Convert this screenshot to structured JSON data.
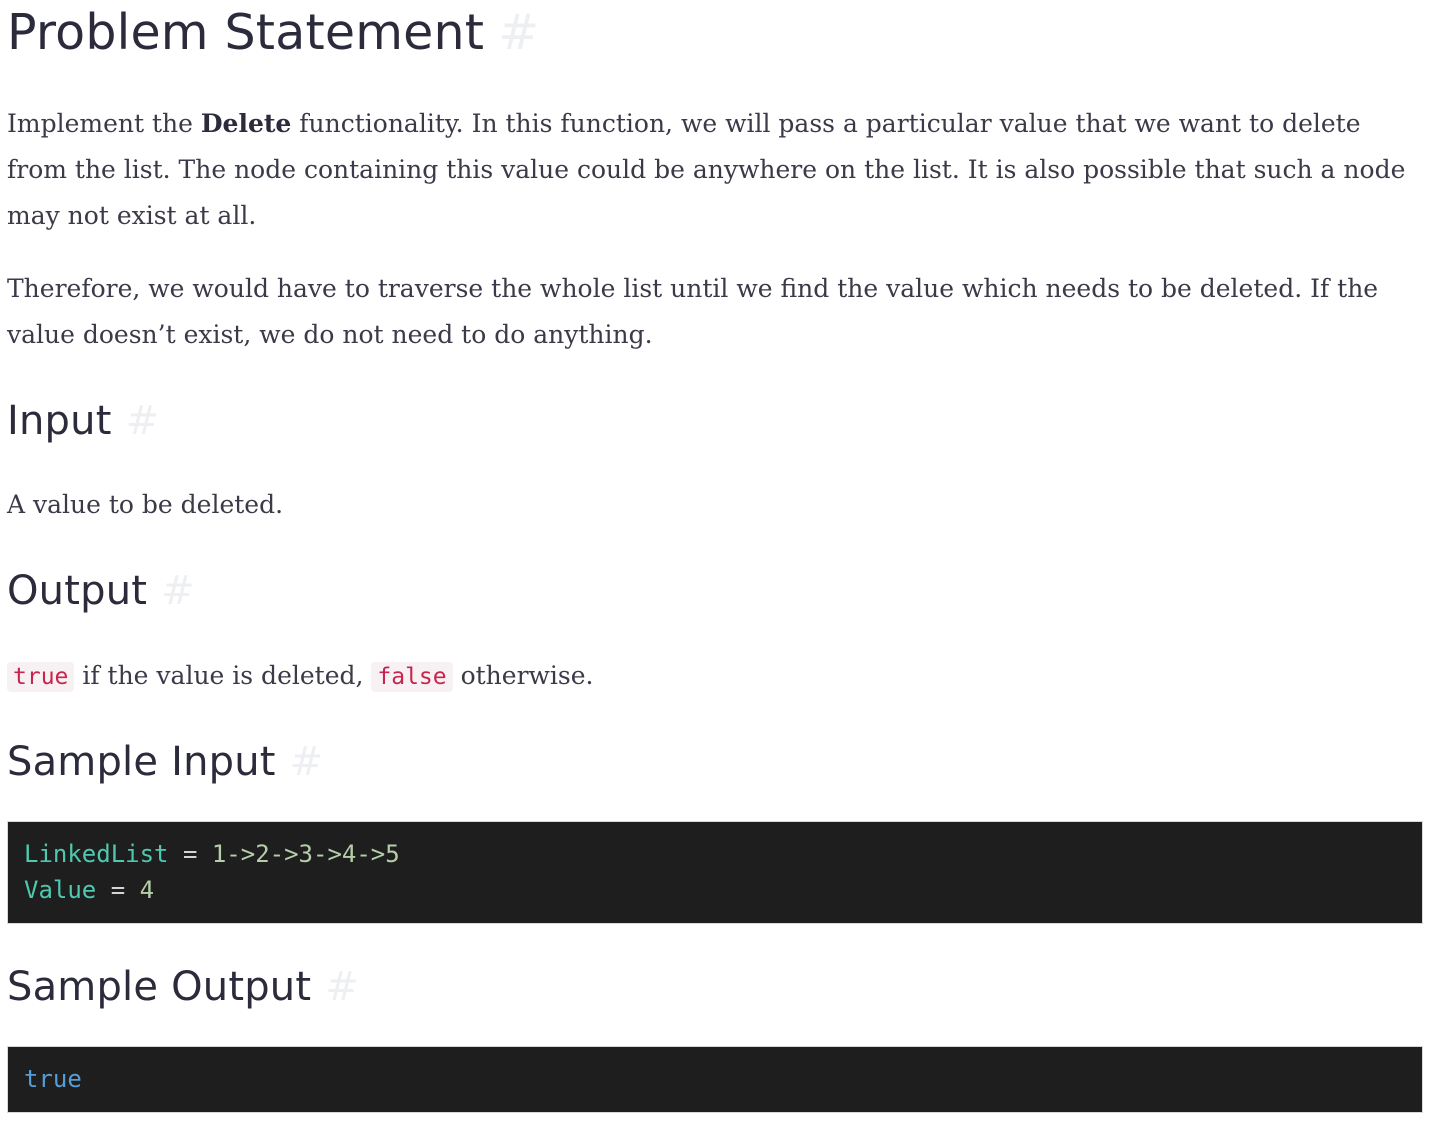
{
  "title": "Problem Statement",
  "anchor_symbol": "#",
  "intro": {
    "prefix": "Implement the ",
    "bold": "Delete",
    "suffix": " functionality. In this function, we will pass a particular value that we want to delete from the list. The node containing this value could be anywhere on the list. It is also possible that such a node may not exist at all."
  },
  "intro2": "Therefore, we would have to traverse the whole list until we find the value which needs to be deleted. If the value doesn’t exist, we do not need to do anything.",
  "input": {
    "heading": "Input",
    "text": "A value to be deleted."
  },
  "output": {
    "heading": "Output",
    "code_true": "true",
    "middle": " if the value is deleted, ",
    "code_false": "false",
    "suffix": " otherwise."
  },
  "sample_input": {
    "heading": "Sample Input",
    "line1": {
      "var": "LinkedList",
      "op": " = ",
      "val": "1->2->3->4->5"
    },
    "line2": {
      "var": "Value",
      "op": " = ",
      "val": "4"
    }
  },
  "sample_output": {
    "heading": "Sample Output",
    "value": "true"
  }
}
